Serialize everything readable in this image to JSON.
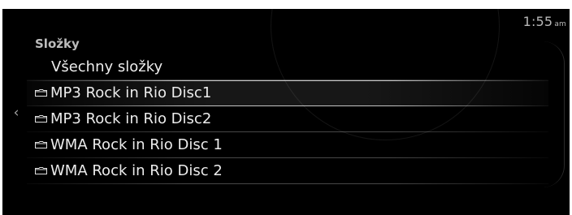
{
  "status": {
    "time": "1:55",
    "ampm": "am"
  },
  "nav": {
    "back_icon": "chevron-left-icon",
    "back_glyph": "‹"
  },
  "folders": {
    "title": "Složky",
    "all_label": "Všechny složky",
    "items": [
      {
        "label": "MP3 Rock in Rio Disc1",
        "icon": "folder-icon",
        "selected": true
      },
      {
        "label": "MP3 Rock in Rio Disc2",
        "icon": "folder-icon",
        "selected": false
      },
      {
        "label": "WMA Rock in Rio Disc 1",
        "icon": "folder-icon",
        "selected": false
      },
      {
        "label": "WMA Rock in Rio Disc 2",
        "icon": "folder-icon",
        "selected": false
      }
    ]
  },
  "colors": {
    "background": "#000000",
    "text": "#ececec",
    "muted_text": "#bcbcbc"
  }
}
